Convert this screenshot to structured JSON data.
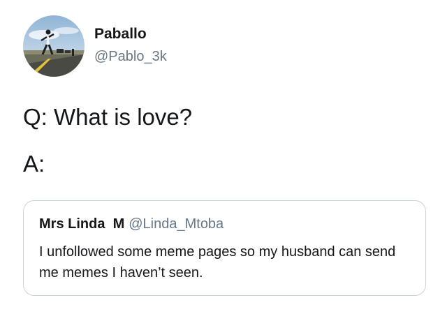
{
  "tweet": {
    "author": {
      "display_name": "Paballo",
      "handle": "@Pablo_3k"
    },
    "question": "Q: What is love?",
    "answer": "A:"
  },
  "quoted_tweet": {
    "author": {
      "display_name": "Mrs Linda  M",
      "handle": "@Linda_Mtoba"
    },
    "text": "I unfollowed some meme pages so my husband can send me memes I haven’t seen."
  },
  "colors": {
    "primary_text": "#14171a",
    "secondary_text": "#657786",
    "quote_border": "#c9d3da",
    "background": "#ffffff"
  }
}
